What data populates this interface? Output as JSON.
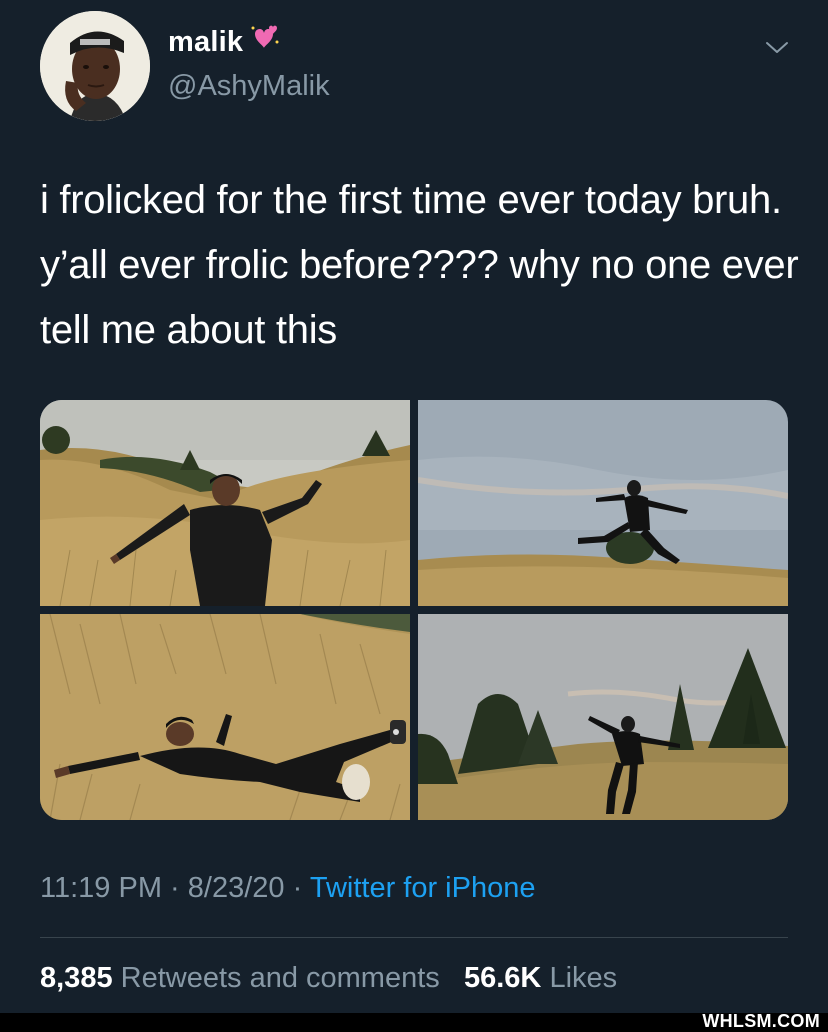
{
  "tweet": {
    "author": {
      "display_name": "malik",
      "name_emoji": "sparkling-heart-icon",
      "handle": "@AshyMalik"
    },
    "text": "i frolicked for the first time ever today bruh. y’all ever frolic before???? why no one ever tell me about this",
    "media": [
      {
        "icon": "photo-man-in-grass-arms-out"
      },
      {
        "icon": "photo-man-leaping-on-hill"
      },
      {
        "icon": "photo-man-lying-in-grass"
      },
      {
        "icon": "photo-man-running-near-trees"
      }
    ],
    "meta": {
      "time": "11:19 PM",
      "separator": "·",
      "date": "8/23/20",
      "source": "Twitter for iPhone"
    },
    "stats": {
      "retweets_count": "8,385",
      "retweets_label": "Retweets and comments",
      "likes_count": "56.6K",
      "likes_label": "Likes"
    }
  },
  "watermark": "WHLSM.COM",
  "colors": {
    "background": "#15202b",
    "secondary_text": "#8899a6",
    "link": "#1da1f2",
    "divider": "#38444d",
    "heart": "#f06ab3"
  }
}
